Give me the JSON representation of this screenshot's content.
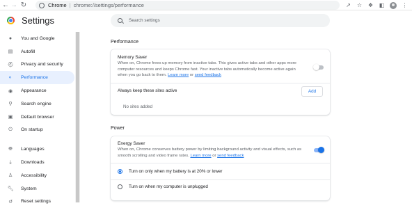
{
  "browser": {
    "nav": {
      "back_icon": "back-arrow-icon",
      "forward_icon": "forward-arrow-icon",
      "reload_icon": "reload-icon"
    },
    "omnibox": {
      "site_label": "Chrome",
      "separator": "|",
      "url": "chrome://settings/performance"
    }
  },
  "header": {
    "title": "Settings",
    "search": {
      "placeholder": "Search settings"
    }
  },
  "sidebar": {
    "items": [
      {
        "label": "You and Google",
        "icon": "person-icon",
        "active": false
      },
      {
        "label": "Autofill",
        "icon": "autofill-icon",
        "active": false
      },
      {
        "label": "Privacy and security",
        "icon": "shield-icon",
        "active": false
      },
      {
        "label": "Performance",
        "icon": "speedometer-icon",
        "active": true
      },
      {
        "label": "Appearance",
        "icon": "palette-icon",
        "active": false
      },
      {
        "label": "Search engine",
        "icon": "search-icon",
        "active": false
      },
      {
        "label": "Default browser",
        "icon": "browser-window-icon",
        "active": false
      },
      {
        "label": "On startup",
        "icon": "power-icon",
        "active": false
      },
      {
        "label": "Languages",
        "icon": "globe-icon",
        "active": false
      },
      {
        "label": "Downloads",
        "icon": "download-icon",
        "active": false
      },
      {
        "label": "Accessibility",
        "icon": "accessibility-icon",
        "active": false
      },
      {
        "label": "System",
        "icon": "wrench-icon",
        "active": false
      },
      {
        "label": "Reset settings",
        "icon": "reset-icon",
        "active": false
      }
    ]
  },
  "performance": {
    "section_title": "Performance",
    "memory_saver": {
      "title": "Memory Saver",
      "description": "When on, Chrome frees up memory from inactive tabs. This gives active tabs and other apps more computer resources and keeps Chrome fast. Your inactive tabs automatically become active again when you go back to them.",
      "learn_more": "Learn more",
      "or": " or ",
      "send_feedback": "send feedback",
      "enabled": false
    },
    "always_keep": {
      "label": "Always keep these sites active",
      "add_label": "Add",
      "empty_text": "No sites added"
    }
  },
  "power": {
    "section_title": "Power",
    "energy_saver": {
      "title": "Energy Saver",
      "description": "When on, Chrome conserves battery power by limiting background activity and visual effects, such as smooth scrolling and video frame rates.",
      "learn_more": "Learn more",
      "or": " or ",
      "send_feedback": "send feedback",
      "enabled": true
    },
    "options": [
      {
        "label": "Turn on only when my battery is at 20% or lower",
        "selected": true
      },
      {
        "label": "Turn on when my computer is unplugged",
        "selected": false
      }
    ]
  },
  "colors": {
    "accent": "#1a73e8",
    "active_bg": "#e8f0fe",
    "text": "#202124",
    "muted": "#5f6368"
  }
}
